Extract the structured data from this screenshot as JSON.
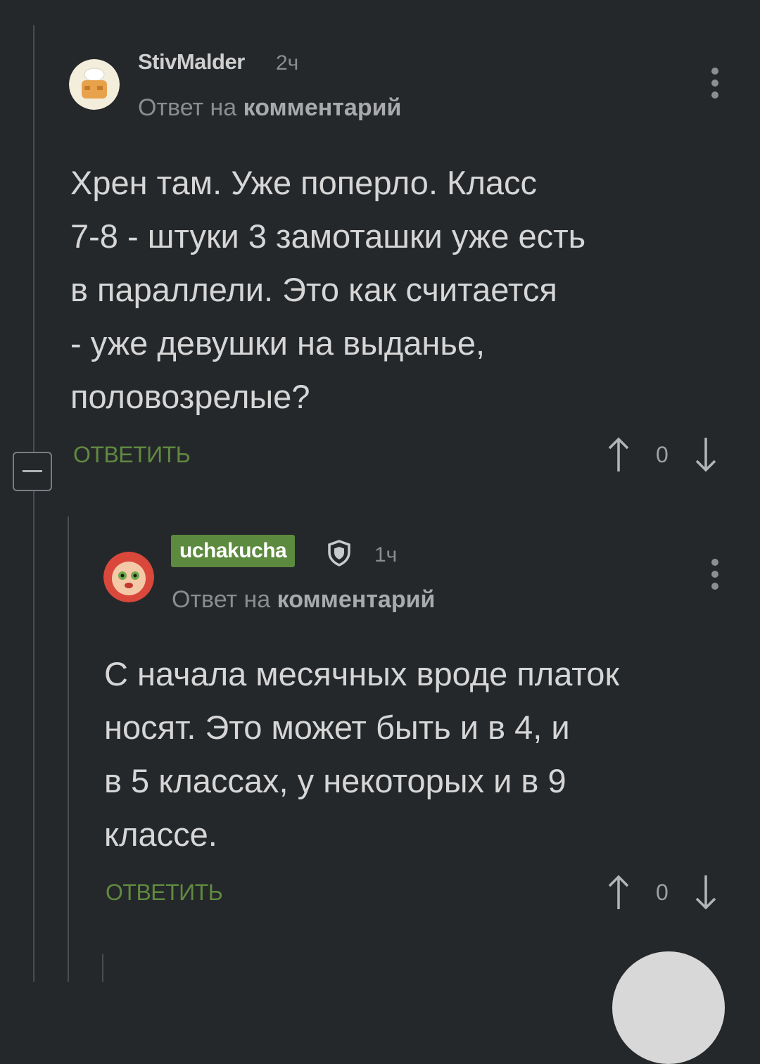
{
  "comments": [
    {
      "username": "StivMalder",
      "time": "2ч",
      "reply_prefix": "Ответ на",
      "reply_target": "комментарий",
      "body": "Хрен там. Уже поперло. Класс\n7-8 - штуки 3 замоташки уже есть\nв параллели. Это как считается\n- уже девушки на выданье,\nполовозрелые?",
      "reply_label": "ОТВЕТИТЬ",
      "score": "0"
    },
    {
      "username": "uchakucha",
      "time": "1ч",
      "reply_prefix": "Ответ на",
      "reply_target": "комментарий",
      "body": "С начала месячных вроде платок\nносят. Это может быть и в 4, и\nв 5 классах, у некоторых и в 9\nклассе.",
      "reply_label": "ОТВЕТИТЬ",
      "score": "0"
    }
  ],
  "colors": {
    "background": "#25282b",
    "accent_green": "#5f8a3f",
    "badge_green": "#5c8a3e"
  }
}
